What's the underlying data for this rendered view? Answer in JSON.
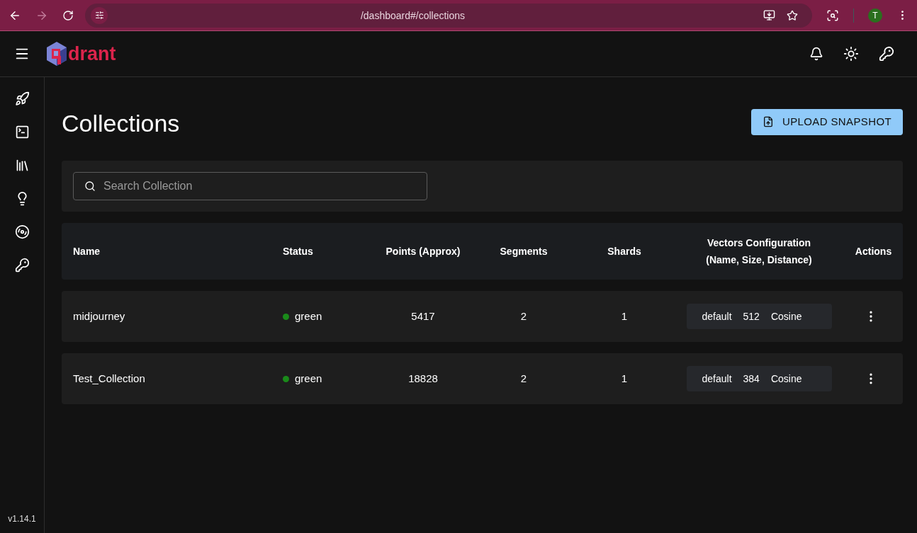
{
  "browser": {
    "url": "/dashboard#/collections",
    "avatar": "T"
  },
  "app": {
    "logo_text": "drant",
    "version": "v1.14.1"
  },
  "page": {
    "title": "Collections",
    "upload_button": "UPLOAD SNAPSHOT"
  },
  "search": {
    "placeholder": "Search Collection"
  },
  "table": {
    "columns": [
      "Name",
      "Status",
      "Points (Approx)",
      "Segments",
      "Shards",
      "Vectors Configuration (Name, Size, Distance)",
      "Actions"
    ],
    "rows": [
      {
        "name": "midjourney",
        "status": "green",
        "color": "#1a8a1a",
        "points": "5417",
        "segments": "2",
        "shards": "1",
        "vectors": [
          "default",
          "512",
          "Cosine"
        ]
      },
      {
        "name": "Test_Collection",
        "status": "green",
        "color": "#1a8a1a",
        "points": "18828",
        "segments": "2",
        "shards": "1",
        "vectors": [
          "default",
          "384",
          "Cosine"
        ]
      }
    ]
  }
}
